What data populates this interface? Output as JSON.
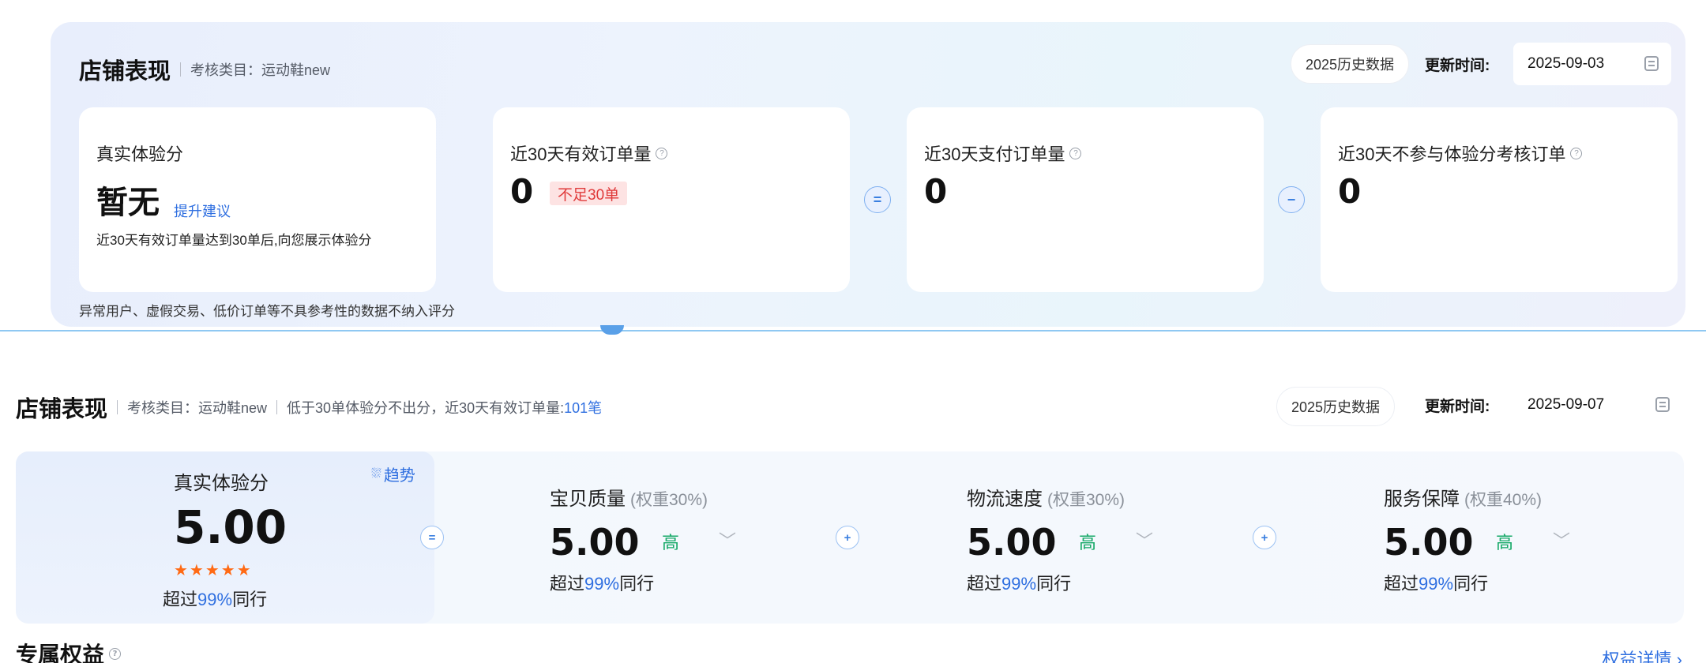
{
  "panel1": {
    "title": "店铺表现",
    "category": "考核类目：运动鞋new",
    "history_button": "2025历史数据",
    "update_label": "更新时间:",
    "update_date": "2025-09-03",
    "cards": [
      {
        "label": "真实体验分",
        "value": "暂无",
        "link": "提升建议",
        "desc": "近30天有效订单量达到30单后,向您展示体验分"
      },
      {
        "label": "近30天有效订单量",
        "value": "0",
        "tag": "不足30单"
      },
      {
        "label": "近30天支付订单量",
        "value": "0"
      },
      {
        "label": "近30天不参与体验分考核订单",
        "value": "0"
      }
    ],
    "operators": [
      "=",
      "−"
    ],
    "footnote": "异常用户、虚假交易、低价订单等不具参考性的数据不纳入评分"
  },
  "panel2": {
    "title": "店铺表现",
    "category": "考核类目：运动鞋new",
    "notice_prefix": "低于30单体验分不出分，近30天有效订单量:",
    "notice_count": "101笔",
    "history_button": "2025历史数据",
    "update_label": "更新时间:",
    "update_date": "2025-09-07",
    "score": {
      "label": "真实体验分",
      "trend_link": "趋势",
      "value": "5.00",
      "stars": "★★★★★",
      "rating": 5,
      "peer_prefix": "超过",
      "peer_pct": "99%",
      "peer_suffix": "同行"
    },
    "operators": [
      "=",
      "+",
      "+"
    ],
    "metrics": [
      {
        "label": "宝贝质量",
        "weight": "(权重30%)",
        "value": "5.00",
        "level": "高",
        "peer_prefix": "超过",
        "peer_pct": "99%",
        "peer_suffix": "同行"
      },
      {
        "label": "物流速度",
        "weight": "(权重30%)",
        "value": "5.00",
        "level": "高",
        "peer_prefix": "超过",
        "peer_pct": "99%",
        "peer_suffix": "同行"
      },
      {
        "label": "服务保障",
        "weight": "(权重40%)",
        "value": "5.00",
        "level": "高",
        "peer_prefix": "超过",
        "peer_pct": "99%",
        "peer_suffix": "同行"
      }
    ]
  },
  "exclusive": {
    "title": "专属权益",
    "details_link": "权益详情 ›"
  },
  "colors": {
    "accent": "#2f6fe0",
    "warning": "#e03a3a",
    "level_high": "#14a866",
    "star": "#ff6a14"
  }
}
